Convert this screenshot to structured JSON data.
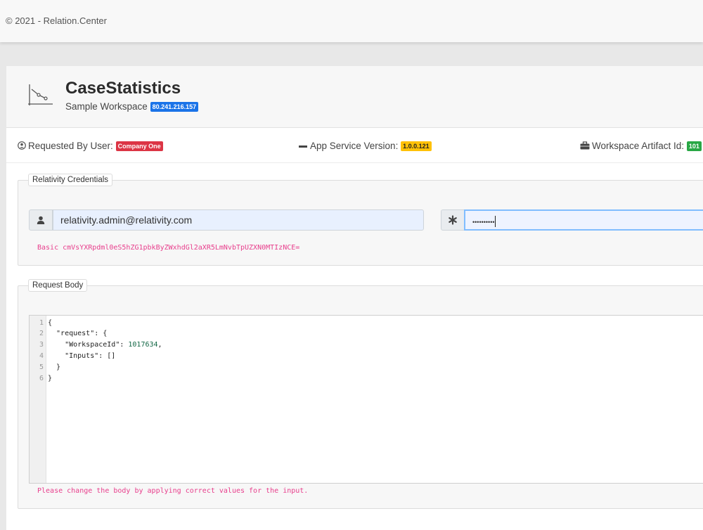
{
  "footer": {
    "copyright": "© 2021 - Relation.Center"
  },
  "header": {
    "title": "CaseStatistics",
    "subtitle": "Sample Workspace",
    "ip_badge": "80.241.216.157"
  },
  "meta": {
    "requested_by_label": "Requested By User:",
    "requested_by_value": "Company One",
    "service_version_label": "App Service Version:",
    "service_version_value": "1.0.0.121",
    "artifact_label": "Workspace Artifact Id:",
    "artifact_value": "101"
  },
  "credentials": {
    "legend": "Relativity Credentials",
    "username": "relativity.admin@relativity.com",
    "password_masked": "••••••••••",
    "basic_token": "Basic cmVsYXRpdml0eS5hZG1pbkByZWxhdGl2aXR5LmNvbTpUZXN0MTIzNCE="
  },
  "request_body": {
    "legend": "Request Body",
    "lines": [
      {
        "n": "1",
        "text": "{"
      },
      {
        "n": "2",
        "text": "  \"request\": {"
      },
      {
        "n": "3",
        "text": "    \"WorkspaceId\": ",
        "num": "1017634",
        "tail": ","
      },
      {
        "n": "4",
        "text": "    \"Inputs\": []"
      },
      {
        "n": "5",
        "text": "  }"
      },
      {
        "n": "6",
        "text": "}"
      }
    ],
    "hint": "Please change the body by applying correct values for the input."
  },
  "colors": {
    "accent_blue": "#1a73e8",
    "badge_red": "#dc3545",
    "badge_yellow": "#ffc107",
    "badge_green": "#28a745",
    "hint_pink": "#e83e8c"
  }
}
